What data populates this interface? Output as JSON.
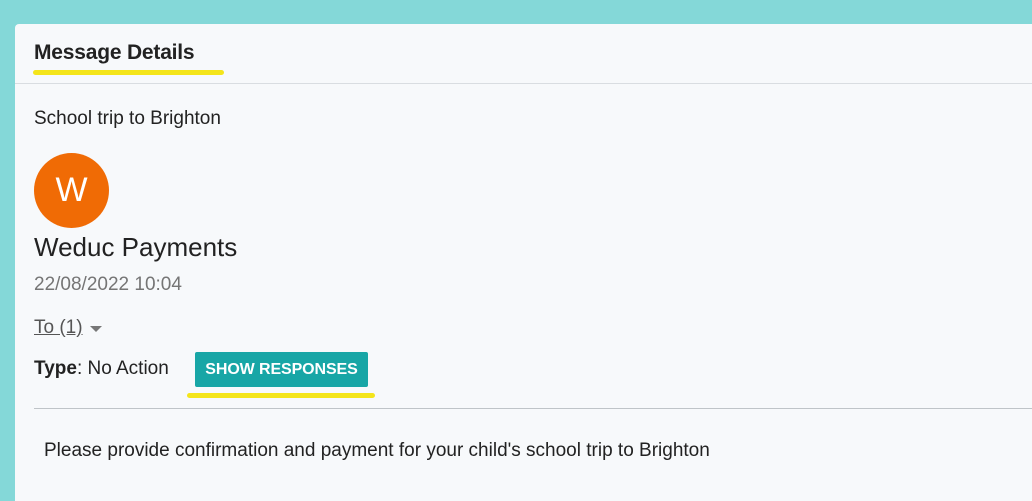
{
  "header": {
    "title": "Message Details"
  },
  "message": {
    "subject": "School trip to Brighton",
    "avatar_letter": "W",
    "avatar_color": "#f06b05",
    "sender": "Weduc Payments",
    "timestamp": "22/08/2022 10:04",
    "recipients_label": "To (1)",
    "type_label": "Type",
    "type_value": ": No Action",
    "show_responses_label": "SHOW RESPONSES",
    "body": "Please provide confirmation and payment for your child's school trip to Brighton"
  },
  "colors": {
    "background": "#84d8d8",
    "accent": "#18a6a6",
    "highlight": "#f4e51b"
  },
  "icons": {
    "recipients_toggle": "caret-down-icon"
  }
}
